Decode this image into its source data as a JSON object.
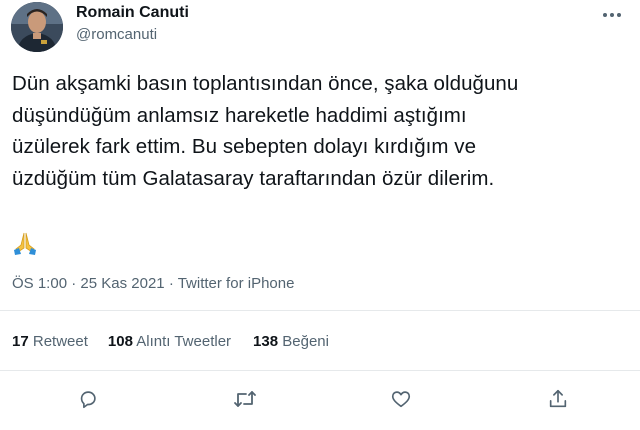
{
  "author": {
    "name": "Romain Canuti",
    "handle": "@romcanuti"
  },
  "tweet": {
    "text": "Dün akşamki basın toplantısından önce, şaka olduğunu\ndüşündüğüm anlamsız hareketle haddimi aştığımı\nüzülerek fark ettim. Bu sebepten dolayı kırdığım ve\nüzdüğüm tüm Galatasaray taraftarından özür dilerim.",
    "emoji": "🙏",
    "time": "ÖS 1:00",
    "separator": "·",
    "date": "25 Kas 2021",
    "source": "Twitter for iPhone"
  },
  "stats": {
    "retweets_count": "17",
    "retweets_label": "Retweet",
    "quotes_count": "108",
    "quotes_label": "Alıntı Tweetler",
    "likes_count": "138",
    "likes_label": "Beğeni"
  },
  "icons": {
    "more": "more-options-icon",
    "reply": "reply-icon",
    "retweet": "retweet-icon",
    "like": "like-icon",
    "share": "share-icon",
    "emoji": "folded-hands-icon"
  },
  "colors": {
    "text": "#0f1419",
    "secondary": "#536471",
    "divider": "#e6e9eb",
    "emoji_skin": "#f5c242"
  }
}
